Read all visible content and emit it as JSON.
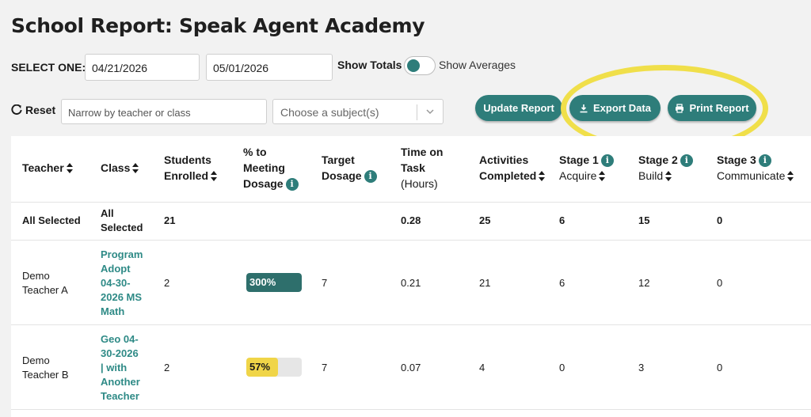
{
  "page": {
    "title": "School Report: Speak Agent Academy"
  },
  "filters": {
    "select_label": "SELECT ONE:",
    "start_date": "04/21/2026",
    "end_date": "05/01/2026",
    "show_totals_label": "Show Totals",
    "show_averages_label": "Show Averages",
    "toggle_state": "totals",
    "reset_label": "Reset",
    "narrow_placeholder": "Narrow by teacher or class",
    "subject_placeholder": "Choose a subject(s)"
  },
  "buttons": {
    "update": "Update Report",
    "export": "Export Data",
    "print": "Print Report"
  },
  "colors": {
    "accent": "#2e7d7a",
    "highlight": "#f0df4a",
    "bar_high": "#2e6f6c",
    "bar_low": "#f0d548"
  },
  "table": {
    "headers": {
      "teacher": "Teacher",
      "class": "Class",
      "students_1": "Students",
      "students_2": "Enrolled",
      "pct_1": "% to",
      "pct_2": "Meeting",
      "pct_3": "Dosage",
      "target_1": "Target",
      "target_2": "Dosage",
      "time_1": "Time on",
      "time_2": "Task",
      "time_3": "(Hours)",
      "act_1": "Activities",
      "act_2": "Completed",
      "s1_1": "Stage 1",
      "s1_2": "Acquire",
      "s2_1": "Stage 2",
      "s2_2": "Build",
      "s3_1": "Stage 3",
      "s3_2": "Communicate"
    },
    "summary": {
      "teacher": "All Selected",
      "class_1": "All",
      "class_2": "Selected",
      "students": "21",
      "time": "0.28",
      "activities": "25",
      "stage1": "6",
      "stage2": "15",
      "stage3": "0"
    },
    "rows": [
      {
        "teacher_1": "Demo",
        "teacher_2": "Teacher A",
        "class_1": "Program",
        "class_2": "Adopt",
        "class_3": "04-30-",
        "class_4": "2026 MS",
        "class_5": "Math",
        "students": "2",
        "pct": "300%",
        "pct_fraction": 1.0,
        "target": "7",
        "time": "0.21",
        "activities": "21",
        "stage1": "6",
        "stage2": "12",
        "stage3": "0"
      },
      {
        "teacher_1": "Demo",
        "teacher_2": "Teacher B",
        "class_1": "Geo 04-",
        "class_2": "30-2026",
        "class_3": "| with",
        "class_4": "Another",
        "class_5": "Teacher",
        "students": "2",
        "pct": "57%",
        "pct_fraction": 0.57,
        "target": "7",
        "time": "0.07",
        "activities": "4",
        "stage1": "0",
        "stage2": "3",
        "stage3": "0"
      }
    ]
  }
}
